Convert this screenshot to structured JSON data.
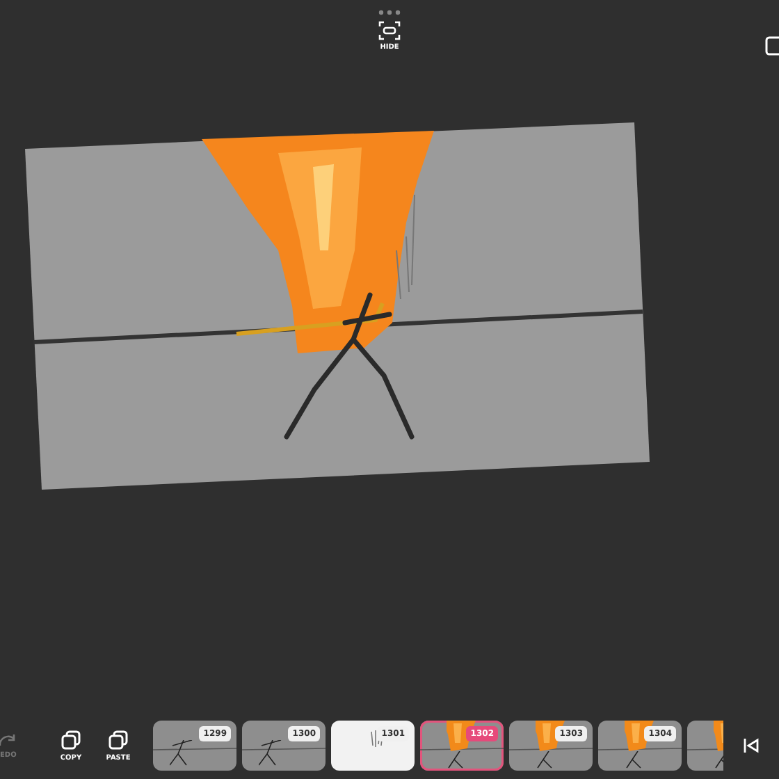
{
  "top_bar": {
    "hide_label": "HIDE"
  },
  "toolbar": [
    {
      "kind": "redo",
      "label": "EDO",
      "disabled": true
    },
    {
      "kind": "copy",
      "label": "COPY",
      "disabled": false
    },
    {
      "kind": "paste",
      "label": "PASTE",
      "disabled": false
    }
  ],
  "frames": [
    {
      "number": "1299",
      "kind": "stick",
      "selected": false
    },
    {
      "number": "1300",
      "kind": "stick",
      "selected": false
    },
    {
      "number": "1301",
      "kind": "blank",
      "selected": false
    },
    {
      "number": "1302",
      "kind": "fire",
      "selected": true
    },
    {
      "number": "1303",
      "kind": "fire",
      "selected": false
    },
    {
      "number": "1304",
      "kind": "fire",
      "selected": false
    },
    {
      "kind": "fire",
      "selected": false
    }
  ]
}
